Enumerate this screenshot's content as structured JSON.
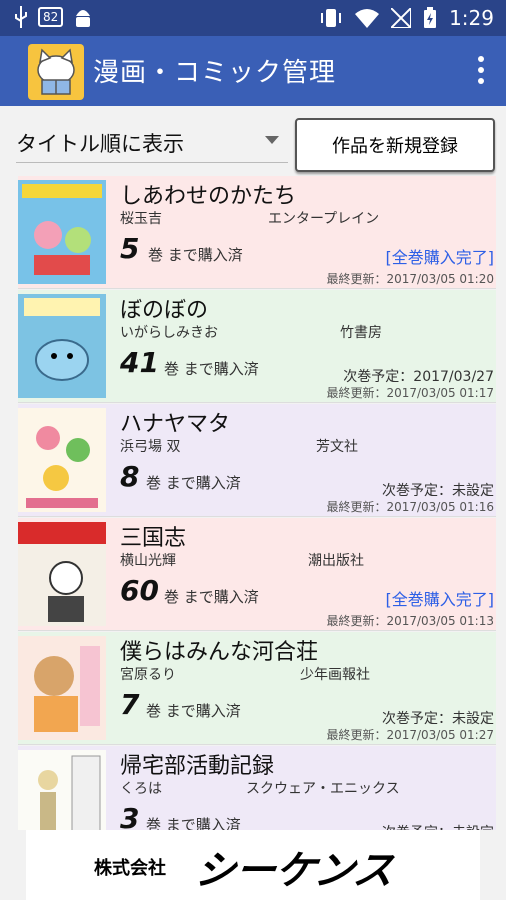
{
  "status_bar": {
    "badge": "82",
    "time": "1:29",
    "icons": [
      "usb-icon",
      "battery-badge",
      "android-icon",
      "vibrate-icon",
      "wifi-icon",
      "no-signal-icon",
      "battery-charging-icon"
    ]
  },
  "app_bar": {
    "title": "漫画・コミック管理",
    "icon": "cat-reading-icon",
    "overflow_icon": "more-vert-icon"
  },
  "toolbar": {
    "sort_value": "タイトル順に表示",
    "new_button": "作品を新規登録"
  },
  "colors": {
    "status_bar": "#2a4489",
    "app_bar": "#3a5fb6",
    "complete": "#2d5fe6",
    "row_pink": "#fde8e8",
    "row_green": "#e8f5e8",
    "row_purple": "#efe9f7"
  },
  "items": [
    {
      "title": "しあわせのかたち",
      "author": "桜玉吉",
      "publisher": "エンタープレイン",
      "vol": "5",
      "vol_label": "巻 まで購入済",
      "complete": "[全巻購入完了]",
      "next": "",
      "updated": "最終更新：2017/03/05 01:20",
      "bg": "#fde8e8"
    },
    {
      "title": "ぼのぼの",
      "author": "いがらしみきお",
      "publisher": "竹書房",
      "vol": "41",
      "vol_label": "巻 まで購入済",
      "complete": "",
      "next": "次巻予定：2017/03/27",
      "updated": "最終更新：2017/03/05 01:17",
      "bg": "#e8f5e8"
    },
    {
      "title": "ハナヤマタ",
      "author": "浜弓場 双",
      "publisher": "芳文社",
      "vol": "8",
      "vol_label": "巻 まで購入済",
      "complete": "",
      "next": "次巻予定：未設定",
      "updated": "最終更新：2017/03/05 01:16",
      "bg": "#efe9f7"
    },
    {
      "title": "三国志",
      "author": "横山光輝",
      "publisher": "潮出版社",
      "vol": "60",
      "vol_label": "巻 まで購入済",
      "complete": "[全巻購入完了]",
      "next": "",
      "updated": "最終更新：2017/03/05 01:13",
      "bg": "#fde8e8"
    },
    {
      "title": "僕らはみんな河合荘",
      "author": "宮原るり",
      "publisher": "少年画報社",
      "vol": "7",
      "vol_label": "巻 まで購入済",
      "complete": "",
      "next": "次巻予定：未設定",
      "updated": "最終更新：2017/03/05 01:27",
      "bg": "#e8f5e8"
    },
    {
      "title": "帰宅部活動記録",
      "author": "くろは",
      "publisher": "スクウェア・エニックス",
      "vol": "3",
      "vol_label": "巻 まで購入済",
      "complete": "",
      "next": "次巻予定：未設定",
      "updated": "",
      "bg": "#efe9f7"
    }
  ],
  "banner": {
    "company": "株式会社",
    "brand": "シーケンス"
  }
}
